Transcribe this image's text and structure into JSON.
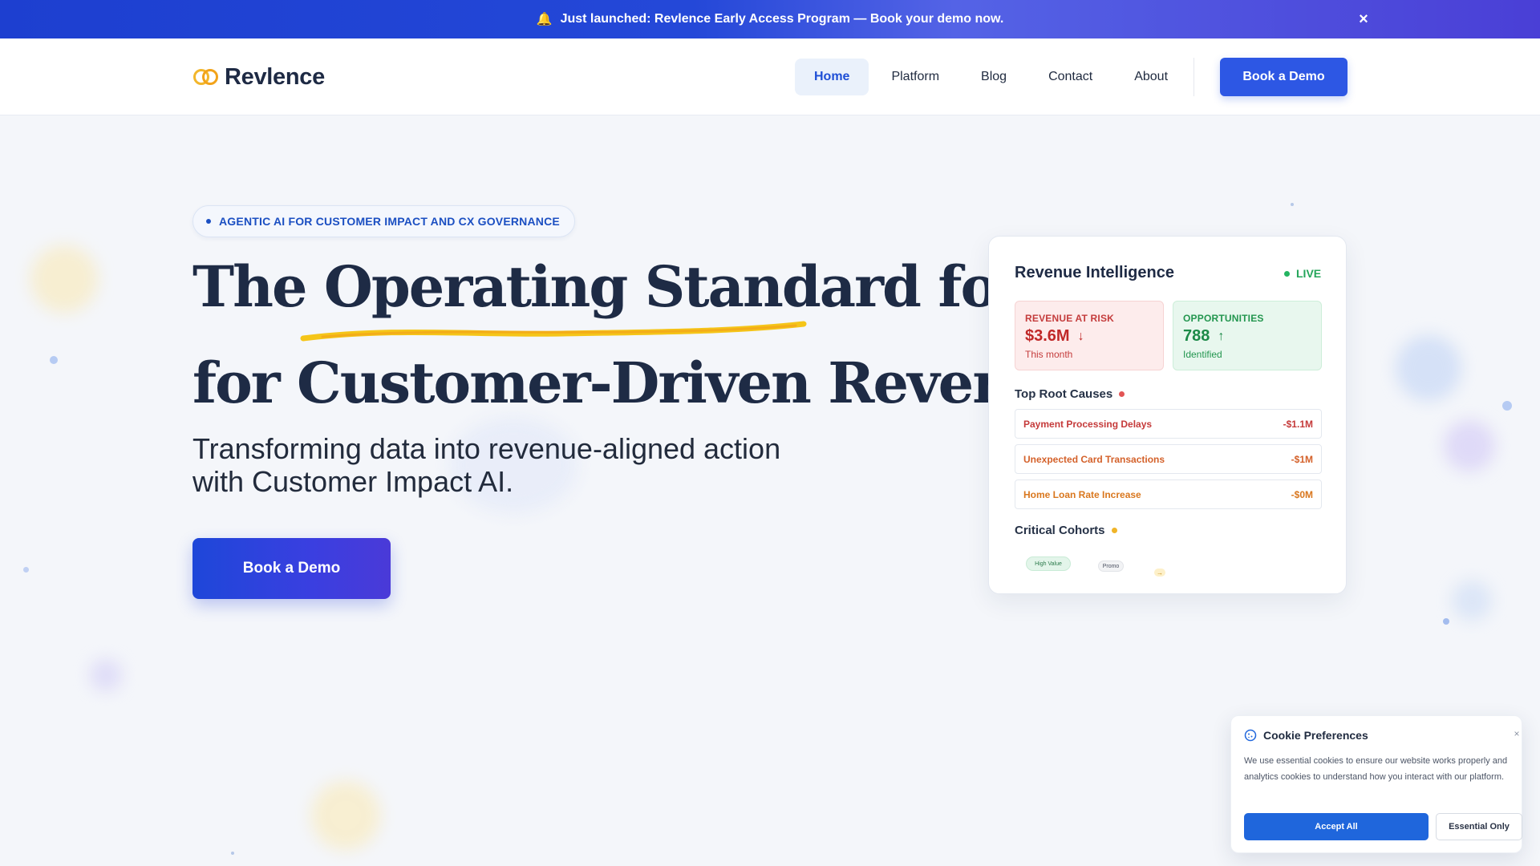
{
  "announcement": {
    "icon": "bell-icon",
    "text": "Just launched: Revlence Early Access Program — Book your demo now.",
    "close_label": "×",
    "gradient_colors": [
      "#1d3fd0",
      "#5463e6",
      "#4a3fd6"
    ]
  },
  "header": {
    "brand": "Revlence",
    "logo_icon": "rings-logo-icon",
    "nav": [
      {
        "label": "Home",
        "active": true
      },
      {
        "label": "Platform",
        "active": false
      },
      {
        "label": "Blog",
        "active": false
      },
      {
        "label": "Contact",
        "active": false
      },
      {
        "label": "About",
        "active": false
      }
    ],
    "cta_label": "Book a Demo",
    "accent_color": "#2d57e4"
  },
  "hero": {
    "badge": "AGENTIC AI FOR CUSTOMER IMPACT AND CX GOVERNANCE",
    "headline_line1": "The Operating Standard for",
    "headline_line2": "for Customer-Driven Revenue",
    "subhead_line1": "Transforming data into revenue-aligned action",
    "subhead_line2": "with Customer Impact AI.",
    "cta_label": "Book a Demo",
    "underline_color": "#f5c518"
  },
  "card": {
    "title": "Revenue Intelligence",
    "live_label": "LIVE",
    "revenue_at_risk": {
      "label": "REVENUE AT RISK",
      "value": "$3.6M",
      "trend_icon": "arrow-down-icon",
      "sub": "This month"
    },
    "opportunities": {
      "label": "OPPORTUNITIES",
      "value": "788",
      "trend_icon": "arrow-up-icon",
      "sub": "Identified"
    },
    "root_causes_title": "Top Root Causes",
    "root_causes": [
      {
        "name": "Payment Processing Delays",
        "impact": "-$1.1M",
        "color": "#c53a3a"
      },
      {
        "name": "Unexpected Card Transactions",
        "impact": "-$1M",
        "color": "#d4612a"
      },
      {
        "name": "Home Loan Rate Increase",
        "impact": "-$0M",
        "color": "#d9771e"
      }
    ],
    "cohorts_title": "Critical Cohorts",
    "cohorts": [
      {
        "label": "High Value"
      },
      {
        "label": "Promo"
      },
      {
        "label": "→"
      }
    ]
  },
  "cookie": {
    "title": "Cookie Preferences",
    "icon": "cookie-icon",
    "close_label": "×",
    "text": "We use essential cookies to ensure our website works properly and analytics cookies to understand how you interact with our platform.",
    "accept_label": "Accept All",
    "essential_label": "Essential Only"
  }
}
